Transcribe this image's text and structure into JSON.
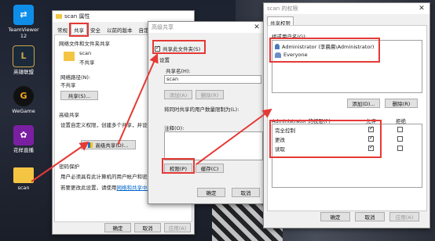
{
  "desktop": {
    "icons": [
      {
        "name": "teamviewer-icon",
        "label1": "TeamViewer",
        "label2": "12"
      },
      {
        "name": "league-icon",
        "label1": "英雄联盟",
        "label2": ""
      },
      {
        "name": "wegame-icon",
        "label1": "WeGame",
        "label2": ""
      },
      {
        "name": "huya-icon",
        "label1": "花样直播",
        "label2": ""
      },
      {
        "name": "folder-icon",
        "label1": "scan",
        "label2": ""
      }
    ]
  },
  "props": {
    "title": "scan 属性",
    "tabs": [
      "常规",
      "共享",
      "安全",
      "以前的版本",
      "自定义"
    ],
    "section1": "网络文件和文件夹共享",
    "folder_name": "scan",
    "folder_status": "不共享",
    "net_path_label": "网络路径(N):",
    "net_path_value": "不共享",
    "share_btn": "共享(S)...",
    "section2": "高级共享",
    "adv_desc": "设置自定义权限，创建多个共享，并设置",
    "adv_btn": "高级共享(D)...",
    "section3": "密码保护",
    "pw_line1": "用户必须具有此计算机的用户帐户和密",
    "pw_line2_prefix": "若要更改此设置，请使用",
    "pw_link": "网络和共享中心",
    "ok": "确定",
    "cancel": "取消",
    "apply": "应用(A)"
  },
  "adv": {
    "title": "高级共享",
    "share_check": "共享此文件夹(S)",
    "settings": "设置",
    "share_name_label": "共享名(H):",
    "share_name_value": "scan",
    "add": "添加(A)",
    "remove": "删除(R)",
    "limit_label": "将同时共享的用户数量限制为(L):",
    "comment_label": "注释(O):",
    "perm_btn": "权限(P)",
    "cache_btn": "缓存(C)",
    "ok": "确定",
    "cancel": "取消"
  },
  "perm": {
    "title": "scan 的权限",
    "tab": "共享权限",
    "group_label": "组或用户名(G):",
    "users": [
      "Administrator (李晨晨\\Administrator)",
      "Everyone"
    ],
    "add": "添加(D)...",
    "remove": "删除(R)",
    "perm_for": "Administrator 的权限(P)",
    "allow": "允许",
    "deny": "拒绝",
    "rows": [
      {
        "name": "完全控制",
        "allow": true,
        "deny": false
      },
      {
        "name": "更改",
        "allow": true,
        "deny": false
      },
      {
        "name": "读取",
        "allow": true,
        "deny": false
      }
    ],
    "ok": "确定",
    "cancel": "取消",
    "apply": "应用(A)"
  },
  "colors": {
    "annotation": "#e53935",
    "accent": "#0066cc"
  }
}
